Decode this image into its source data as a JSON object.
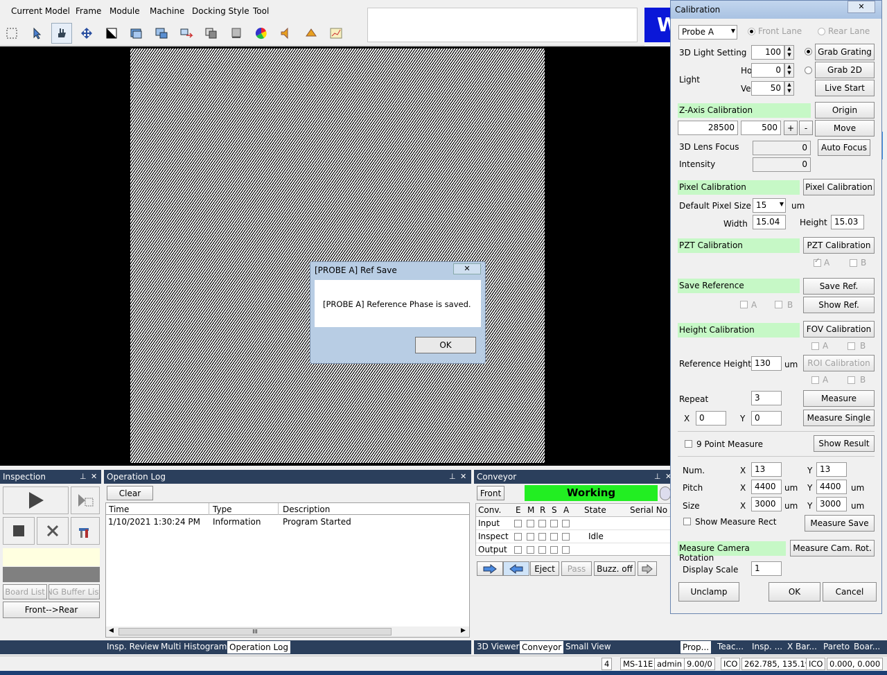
{
  "menu": [
    "Current Model",
    "Frame",
    "Module",
    "Machine",
    "Docking Style",
    "Tool"
  ],
  "banner_text": "W",
  "dialog": {
    "title": "[PROBE A] Ref Save",
    "message": "[PROBE A] Reference Phase is saved.",
    "ok": "OK",
    "close": "✕"
  },
  "inspection": {
    "title": "Inspection",
    "board_list": "Board List",
    "ng_buffer": "NG Buffer List",
    "direction": "Front-->Rear"
  },
  "oplog": {
    "title": "Operation Log",
    "clear": "Clear",
    "columns": [
      "Time",
      "Type",
      "Description"
    ],
    "rows": [
      [
        "1/10/2021 1:30:24 PM",
        "Information",
        "Program Started"
      ]
    ],
    "scroll_grip": "III",
    "tabs": [
      "Insp. Review",
      "Multi Histogram",
      "Operation Log"
    ]
  },
  "conveyor": {
    "title": "Conveyor",
    "front": "Front",
    "status": "Working",
    "columns": [
      "Conv.",
      "E",
      "M",
      "R",
      "S",
      "A",
      "State",
      "Serial No"
    ],
    "rows": [
      {
        "name": "Input",
        "state": ""
      },
      {
        "name": "Inspect",
        "state": "Idle"
      },
      {
        "name": "Output",
        "state": ""
      }
    ],
    "eject": "Eject",
    "pass": "Pass",
    "buzz": "Buzz. off",
    "tabs": [
      "3D Viewer",
      "Conveyor",
      "Small View"
    ]
  },
  "right_tabs": [
    "Prop...",
    "Teac...",
    "Insp. ...",
    "X Bar...",
    "Pareto",
    "Boar..."
  ],
  "calibration": {
    "title": "Calibration",
    "close": "✕",
    "probe": "Probe A",
    "front_lane": "Front Lane",
    "rear_lane": "Rear Lane",
    "light_setting_label": "3D Light Setting",
    "light_setting_value": "100",
    "grab_grating": "Grab Grating",
    "light_label": "Light",
    "horz_label": "Horz.",
    "horz_value": "0",
    "vert_label": "Vert.",
    "vert_value": "50",
    "grab_2d": "Grab 2D",
    "live_start": "Live Start",
    "z_axis": "Z-Axis Calibration",
    "origin": "Origin",
    "z_value": "28500",
    "z_step": "500",
    "plus": "+",
    "minus": "-",
    "move": "Move",
    "lens_focus_label": "3D Lens Focus",
    "lens_focus_value": "0",
    "auto_focus": "Auto Focus",
    "intensity_label": "Intensity",
    "intensity_value": "0",
    "pixel_cal": "Pixel Calibration",
    "pixel_cal_btn": "Pixel Calibration",
    "default_pixel_label": "Default Pixel Size",
    "default_pixel_value": "15",
    "um": "um",
    "width_label": "Width",
    "width_value": "15.04",
    "height_label": "Height",
    "height_value": "15.03",
    "pzt_cal": "PZT Calibration",
    "pzt_cal_btn": "PZT Calibration",
    "a": "A",
    "b": "B",
    "save_reference": "Save Reference",
    "save_ref_btn": "Save Ref.",
    "show_ref_btn": "Show Ref.",
    "height_cal": "Height Calibration",
    "fov_cal_btn": "FOV Calibration",
    "ref_height_label": "Reference Height",
    "ref_height_value": "130",
    "roi_cal_btn": "ROI Calibration",
    "repeat_label": "Repeat",
    "repeat_value": "3",
    "measure_btn": "Measure",
    "x_label": "X",
    "x_value": "0",
    "y_label": "Y",
    "y_value": "0",
    "measure_single_btn": "Measure Single",
    "nine_point": "9 Point Measure",
    "show_result_btn": "Show Result",
    "num_label": "Num.",
    "num_x": "13",
    "num_y": "13",
    "pitch_label": "Pitch",
    "pitch_x": "4400",
    "pitch_y": "4400",
    "size_label": "Size",
    "size_x": "3000",
    "size_y": "3000",
    "show_rect": "Show Measure Rect",
    "measure_save_btn": "Measure Save",
    "cam_rotation": "Measure Camera Rotation",
    "cam_rot_btn": "Measure Cam. Rot.",
    "display_scale_label": "Display Scale",
    "display_scale_value": "1",
    "unclamp": "Unclamp",
    "ok": "OK",
    "cancel": "Cancel"
  },
  "statusbar": [
    "4",
    "MS-11E",
    "admin",
    "9.00/0",
    "ICO",
    "262.785, 135.196",
    "ICO",
    "0.000, 0.000"
  ]
}
